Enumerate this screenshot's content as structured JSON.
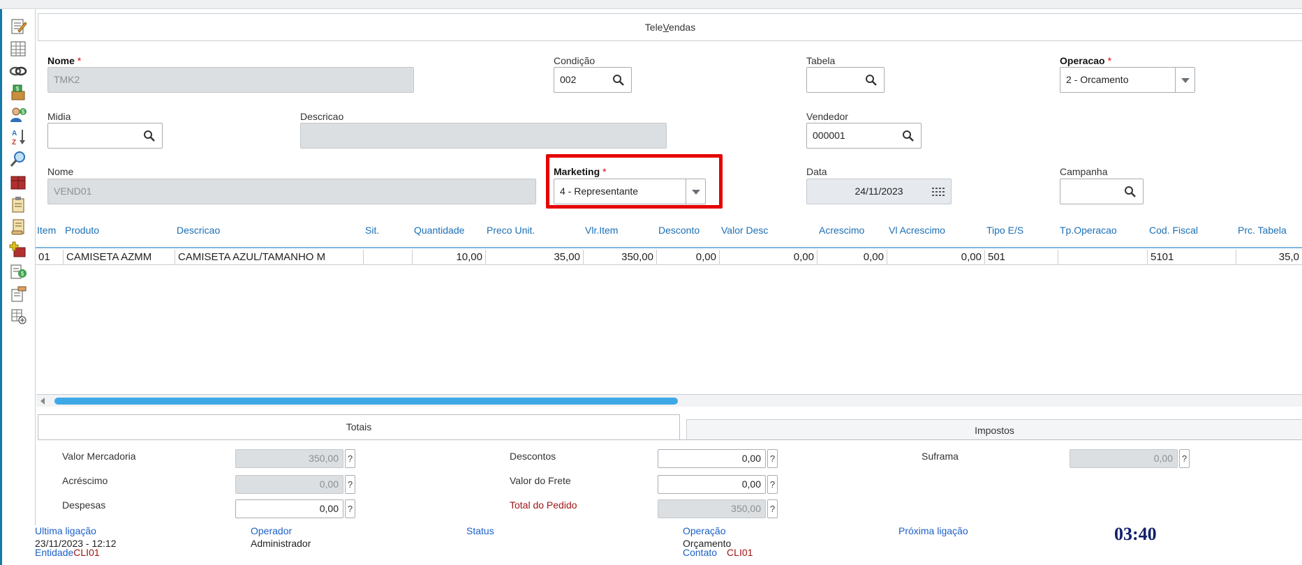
{
  "window": {
    "title_pre": "Tele",
    "title_u": "V",
    "title_post": "endas"
  },
  "toolbar": [
    "edit-icon",
    "spreadsheet-icon",
    "link-icon",
    "money-box-icon",
    "user-money-icon",
    "sort-az-icon",
    "search-icon",
    "package-icon",
    "clipboard-icon",
    "scroll-icon",
    "add-box-icon",
    "money-doc-icon",
    "hand-doc-icon",
    "table-add-icon"
  ],
  "form": {
    "nome_label": "Nome",
    "nome_value": "TMK2",
    "condicao_label": "Condição",
    "condicao_value": "002",
    "tabela_label": "Tabela",
    "tabela_value": "",
    "operacao_label": "Operacao",
    "operacao_value": "2 - Orcamento",
    "midia_label": "Midia",
    "midia_value": "",
    "descricao_label": "Descricao",
    "descricao_value": "",
    "vendedor_label": "Vendedor",
    "vendedor_value": "000001",
    "nome2_label": "Nome",
    "nome2_value": "VEND01",
    "marketing_label": "Marketing",
    "marketing_value": "4 - Representante",
    "data_label": "Data",
    "data_value": "24/11/2023",
    "campanha_label": "Campanha",
    "campanha_value": "",
    "required_mark": "*"
  },
  "grid": {
    "headers": [
      "Item",
      "Produto",
      "Descricao",
      "Sit.",
      "Quantidade",
      "Preco Unit.",
      "Vlr.Item",
      "Desconto",
      "Valor Desc",
      "Acrescimo",
      "Vl Acrescimo",
      "Tipo E/S",
      "Tp.Operacao",
      "Cod. Fiscal",
      "Prc. Tabela"
    ],
    "row": [
      "01",
      "CAMISETA   AZMM",
      "CAMISETA AZUL/TAMANHO M",
      "",
      "10,00",
      "35,00",
      "350,00",
      "0,00",
      "0,00",
      "0,00",
      "0,00",
      "501",
      "",
      "5101",
      "35,0"
    ]
  },
  "tabs": {
    "totais": "Totais",
    "impostos": "Impostos"
  },
  "totais": {
    "valor_mercadoria_label": "Valor Mercadoria",
    "valor_mercadoria": "350,00",
    "acrescimo_label": "Acréscimo",
    "acrescimo": "0,00",
    "despesas_label": "Despesas",
    "despesas": "0,00",
    "descontos_label": "Descontos",
    "descontos": "0,00",
    "frete_label": "Valor do Frete",
    "frete": "0,00",
    "total_label": "Total do Pedido",
    "total": "350,00",
    "suframa_label": "Suframa",
    "suframa": "0,00",
    "help": "?"
  },
  "footer": {
    "ultima_label": "Ultima ligação",
    "ultima_value": "23/11/2023 - 12:12",
    "entidade_label": "Entidade",
    "entidade_value": "CLI01",
    "operador_label": "Operador",
    "operador_value": "Administrador",
    "status_label": "Status",
    "operacao_label": "Operação",
    "operacao_value": "Orçamento",
    "contato_label": "Contato",
    "contato_value": "CLI01",
    "proxima_label": "Próxima ligação",
    "clock": "03:40"
  },
  "colors": {
    "accent": "#1b6fb5",
    "highlight": "#e60000",
    "scroll": "#3fa9e8",
    "required": "#e00000"
  }
}
